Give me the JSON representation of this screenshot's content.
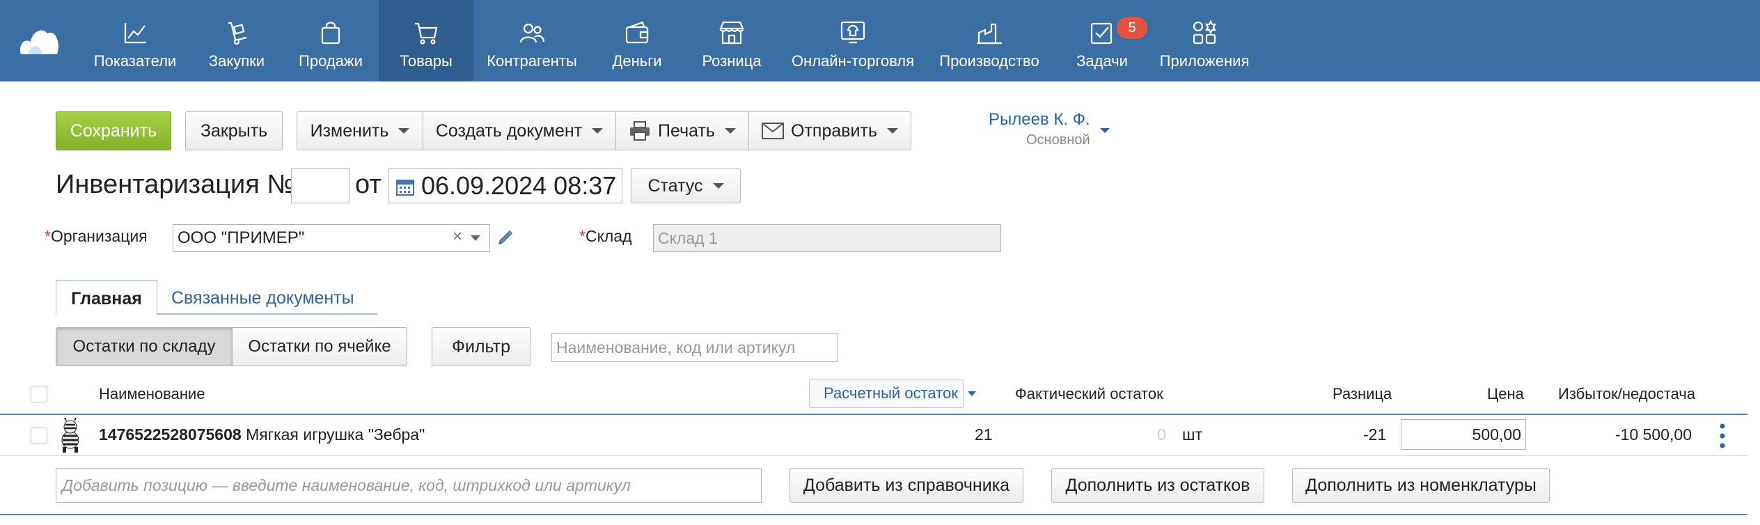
{
  "colors": {
    "nav_bg": "#3a6fa5",
    "nav_active": "#2e5e8f",
    "accent_green": "#8cbc31",
    "link": "#2c63a0",
    "badge": "#e2543f"
  },
  "nav": {
    "logo_icon": "cloud-logo-icon",
    "items": [
      {
        "label": "Показатели",
        "icon": "chart-line-icon"
      },
      {
        "label": "Закупки",
        "icon": "cart-trolley-icon"
      },
      {
        "label": "Продажи",
        "icon": "shopping-bag-icon"
      },
      {
        "label": "Товары",
        "icon": "shopping-cart-icon",
        "active": true
      },
      {
        "label": "Контрагенты",
        "icon": "people-icon"
      },
      {
        "label": "Деньги",
        "icon": "wallet-icon"
      },
      {
        "label": "Розница",
        "icon": "storefront-icon"
      },
      {
        "label": "Онлайн-торговля",
        "icon": "online-shop-icon"
      },
      {
        "label": "Производство",
        "icon": "factory-icon"
      },
      {
        "label": "Задачи",
        "icon": "tasks-check-icon",
        "badge": "5"
      },
      {
        "label": "Приложения",
        "icon": "apps-grid-icon"
      }
    ]
  },
  "toolbar": {
    "save": "Сохранить",
    "close": "Закрыть",
    "edit": "Изменить",
    "create_doc": "Создать документ",
    "print": "Печать",
    "send": "Отправить"
  },
  "user": {
    "name": "Рылеев К. Ф.",
    "role": "Основной"
  },
  "doc": {
    "title": "Инвентаризация №",
    "number": "",
    "from": "от",
    "date": "06.09.2024 08:37",
    "status": "Статус"
  },
  "form": {
    "org_label": "Организация",
    "org_value": "ООО \"ПРИМЕР\"",
    "store_label": "Склад",
    "store_placeholder": "Склад 1"
  },
  "tabs": {
    "main": "Главная",
    "related": "Связанные документы"
  },
  "filters": {
    "by_store": "Остатки по складу",
    "by_cell": "Остатки по ячейке",
    "filter": "Фильтр",
    "search_placeholder": "Наименование, код или артикул"
  },
  "table": {
    "headers": {
      "name": "Наименование",
      "calc": "Расчетный остаток",
      "actual": "Фактический остаток",
      "diff": "Разница",
      "price": "Цена",
      "surplus": "Избыток/недостача"
    },
    "rows": [
      {
        "code": "1476522528075608",
        "name": "Мягкая игрушка \"Зебра\"",
        "calc": "21",
        "actual": "0",
        "unit": "шт",
        "diff": "-21",
        "price": "500,00",
        "surplus": "-10 500,00"
      }
    ]
  },
  "add_row": {
    "placeholder": "Добавить позицию — введите наименование, код, штрихкод или артикул",
    "from_catalog": "Добавить из справочника",
    "from_stock": "Дополнить из остатков",
    "from_nomenclature": "Дополнить из номенклатуры"
  }
}
